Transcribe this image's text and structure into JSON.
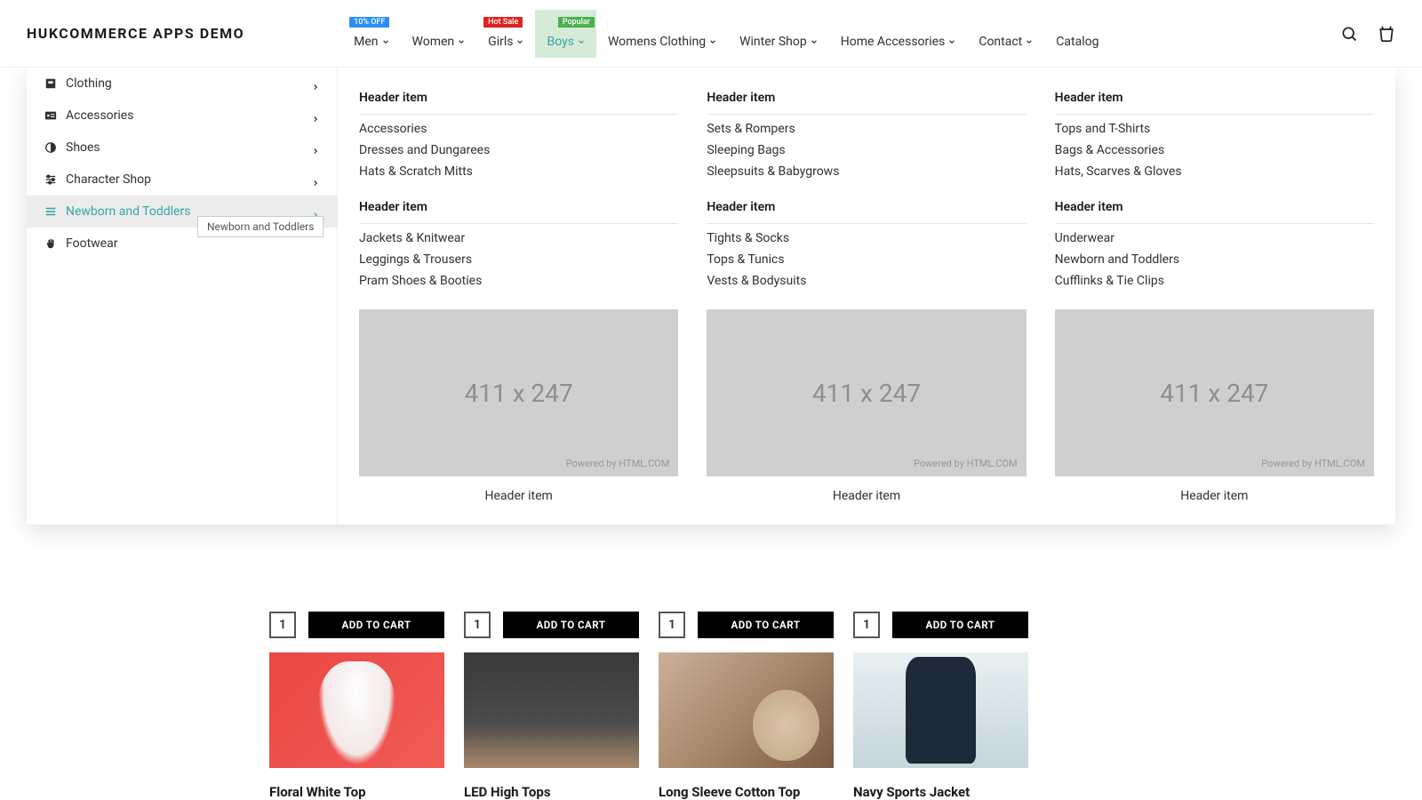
{
  "logo": "HUKCOMMERCE APPS DEMO",
  "nav": [
    {
      "label": "Men",
      "badge": "10% OFF",
      "badge_class": "badge-blue",
      "chevron": true
    },
    {
      "label": "Women",
      "chevron": true
    },
    {
      "label": "Girls",
      "badge": "Hot Sale",
      "badge_class": "badge-red",
      "chevron": true
    },
    {
      "label": "Boys",
      "badge": "Popular",
      "badge_class": "badge-green",
      "chevron": true,
      "active": true
    },
    {
      "label": "Womens Clothing",
      "chevron": true
    },
    {
      "label": "Winter Shop",
      "chevron": true
    },
    {
      "label": "Home Accessories",
      "chevron": true
    },
    {
      "label": "Contact",
      "chevron": true
    },
    {
      "label": "Catalog",
      "chevron": false
    }
  ],
  "side_categories": [
    {
      "label": "Clothing",
      "icon": "contact"
    },
    {
      "label": "Accessories",
      "icon": "id"
    },
    {
      "label": "Shoes",
      "icon": "contrast"
    },
    {
      "label": "Character Shop",
      "icon": "settings"
    },
    {
      "label": "Newborn and Toddlers",
      "icon": "lines",
      "active": true
    },
    {
      "label": "Footwear",
      "icon": "hand",
      "no_chevron": true
    }
  ],
  "tooltip": "Newborn and Toddlers",
  "mega_columns": [
    {
      "group1": {
        "header": "Header item",
        "links": [
          "Accessories",
          "Dresses and Dungarees",
          "Hats & Scratch Mitts"
        ]
      },
      "group2": {
        "header": "Header item",
        "links": [
          "Jackets & Knitwear",
          "Leggings & Trousers",
          "Pram Shoes & Booties"
        ]
      },
      "placeholder": "411 x 247",
      "credit": "Powered by HTML.COM",
      "caption": "Header item"
    },
    {
      "group1": {
        "header": "Header item",
        "links": [
          "Sets & Rompers",
          "Sleeping Bags",
          "Sleepsuits & Babygrows"
        ]
      },
      "group2": {
        "header": "Header item",
        "links": [
          "Tights & Socks",
          "Tops & Tunics",
          "Vests & Bodysuits"
        ]
      },
      "placeholder": "411 x 247",
      "credit": "Powered by HTML.COM",
      "caption": "Header item"
    },
    {
      "group1": {
        "header": "Header item",
        "links": [
          "Tops and T-Shirts",
          "Bags & Accessories",
          "Hats, Scarves & Gloves"
        ]
      },
      "group2": {
        "header": "Header item",
        "links": [
          "Underwear",
          "Newborn and Toddlers",
          "Cufflinks & Tie Clips"
        ]
      },
      "placeholder": "411 x 247",
      "credit": "Powered by HTML.COM",
      "caption": "Header item"
    }
  ],
  "products": [
    {
      "title": "Floral White Top",
      "qty": "1",
      "btn": "ADD TO CART",
      "img": "pi1"
    },
    {
      "title": "LED High Tops",
      "qty": "1",
      "btn": "ADD TO CART",
      "img": "pi2"
    },
    {
      "title": "Long Sleeve Cotton Top",
      "qty": "1",
      "btn": "ADD TO CART",
      "img": "pi3"
    },
    {
      "title": "Navy Sports Jacket",
      "qty": "1",
      "btn": "ADD TO CART",
      "img": "pi4"
    }
  ]
}
